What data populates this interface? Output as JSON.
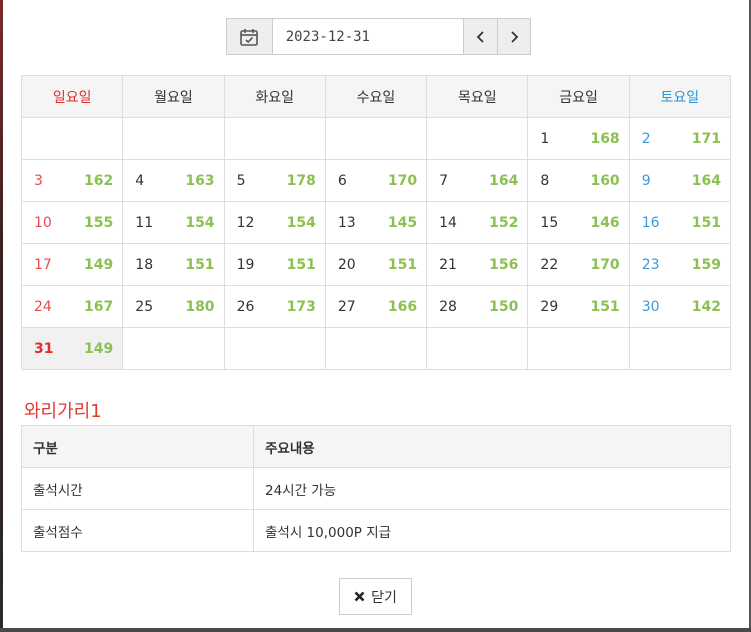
{
  "datepicker": {
    "value": "2023-12-31"
  },
  "weekdays": [
    "일요일",
    "월요일",
    "화요일",
    "수요일",
    "목요일",
    "금요일",
    "토요일"
  ],
  "weeks": [
    [
      {
        "d": "",
        "c": ""
      },
      {
        "d": "",
        "c": ""
      },
      {
        "d": "",
        "c": ""
      },
      {
        "d": "",
        "c": ""
      },
      {
        "d": "",
        "c": ""
      },
      {
        "d": "1",
        "c": "168"
      },
      {
        "d": "2",
        "c": "171"
      }
    ],
    [
      {
        "d": "3",
        "c": "162"
      },
      {
        "d": "4",
        "c": "163"
      },
      {
        "d": "5",
        "c": "178"
      },
      {
        "d": "6",
        "c": "170"
      },
      {
        "d": "7",
        "c": "164"
      },
      {
        "d": "8",
        "c": "160"
      },
      {
        "d": "9",
        "c": "164"
      }
    ],
    [
      {
        "d": "10",
        "c": "155"
      },
      {
        "d": "11",
        "c": "154"
      },
      {
        "d": "12",
        "c": "154"
      },
      {
        "d": "13",
        "c": "145"
      },
      {
        "d": "14",
        "c": "152"
      },
      {
        "d": "15",
        "c": "146"
      },
      {
        "d": "16",
        "c": "151"
      }
    ],
    [
      {
        "d": "17",
        "c": "149"
      },
      {
        "d": "18",
        "c": "151"
      },
      {
        "d": "19",
        "c": "151"
      },
      {
        "d": "20",
        "c": "151"
      },
      {
        "d": "21",
        "c": "156"
      },
      {
        "d": "22",
        "c": "170"
      },
      {
        "d": "23",
        "c": "159"
      }
    ],
    [
      {
        "d": "24",
        "c": "167"
      },
      {
        "d": "25",
        "c": "180"
      },
      {
        "d": "26",
        "c": "173"
      },
      {
        "d": "27",
        "c": "166"
      },
      {
        "d": "28",
        "c": "150"
      },
      {
        "d": "29",
        "c": "151"
      },
      {
        "d": "30",
        "c": "142"
      }
    ],
    [
      {
        "d": "31",
        "c": "149"
      },
      {
        "d": "",
        "c": ""
      },
      {
        "d": "",
        "c": ""
      },
      {
        "d": "",
        "c": ""
      },
      {
        "d": "",
        "c": ""
      },
      {
        "d": "",
        "c": ""
      },
      {
        "d": "",
        "c": ""
      }
    ]
  ],
  "info": {
    "title": "와리가리1",
    "headers": [
      "구분",
      "주요내용"
    ],
    "rows": [
      [
        "출석시간",
        "24시간 가능"
      ],
      [
        "출석점수",
        "출석시 10,000P 지급"
      ]
    ]
  },
  "close_label": "닫기",
  "colors": {
    "sunday": "#e02d2d",
    "saturday": "#2b95d6",
    "count": "#8cc152",
    "title": "#e03b2c"
  },
  "icons": {
    "calendar": "calendar-icon",
    "prev": "chevron-left-icon",
    "next": "chevron-right-icon",
    "close": "close-x-icon"
  }
}
